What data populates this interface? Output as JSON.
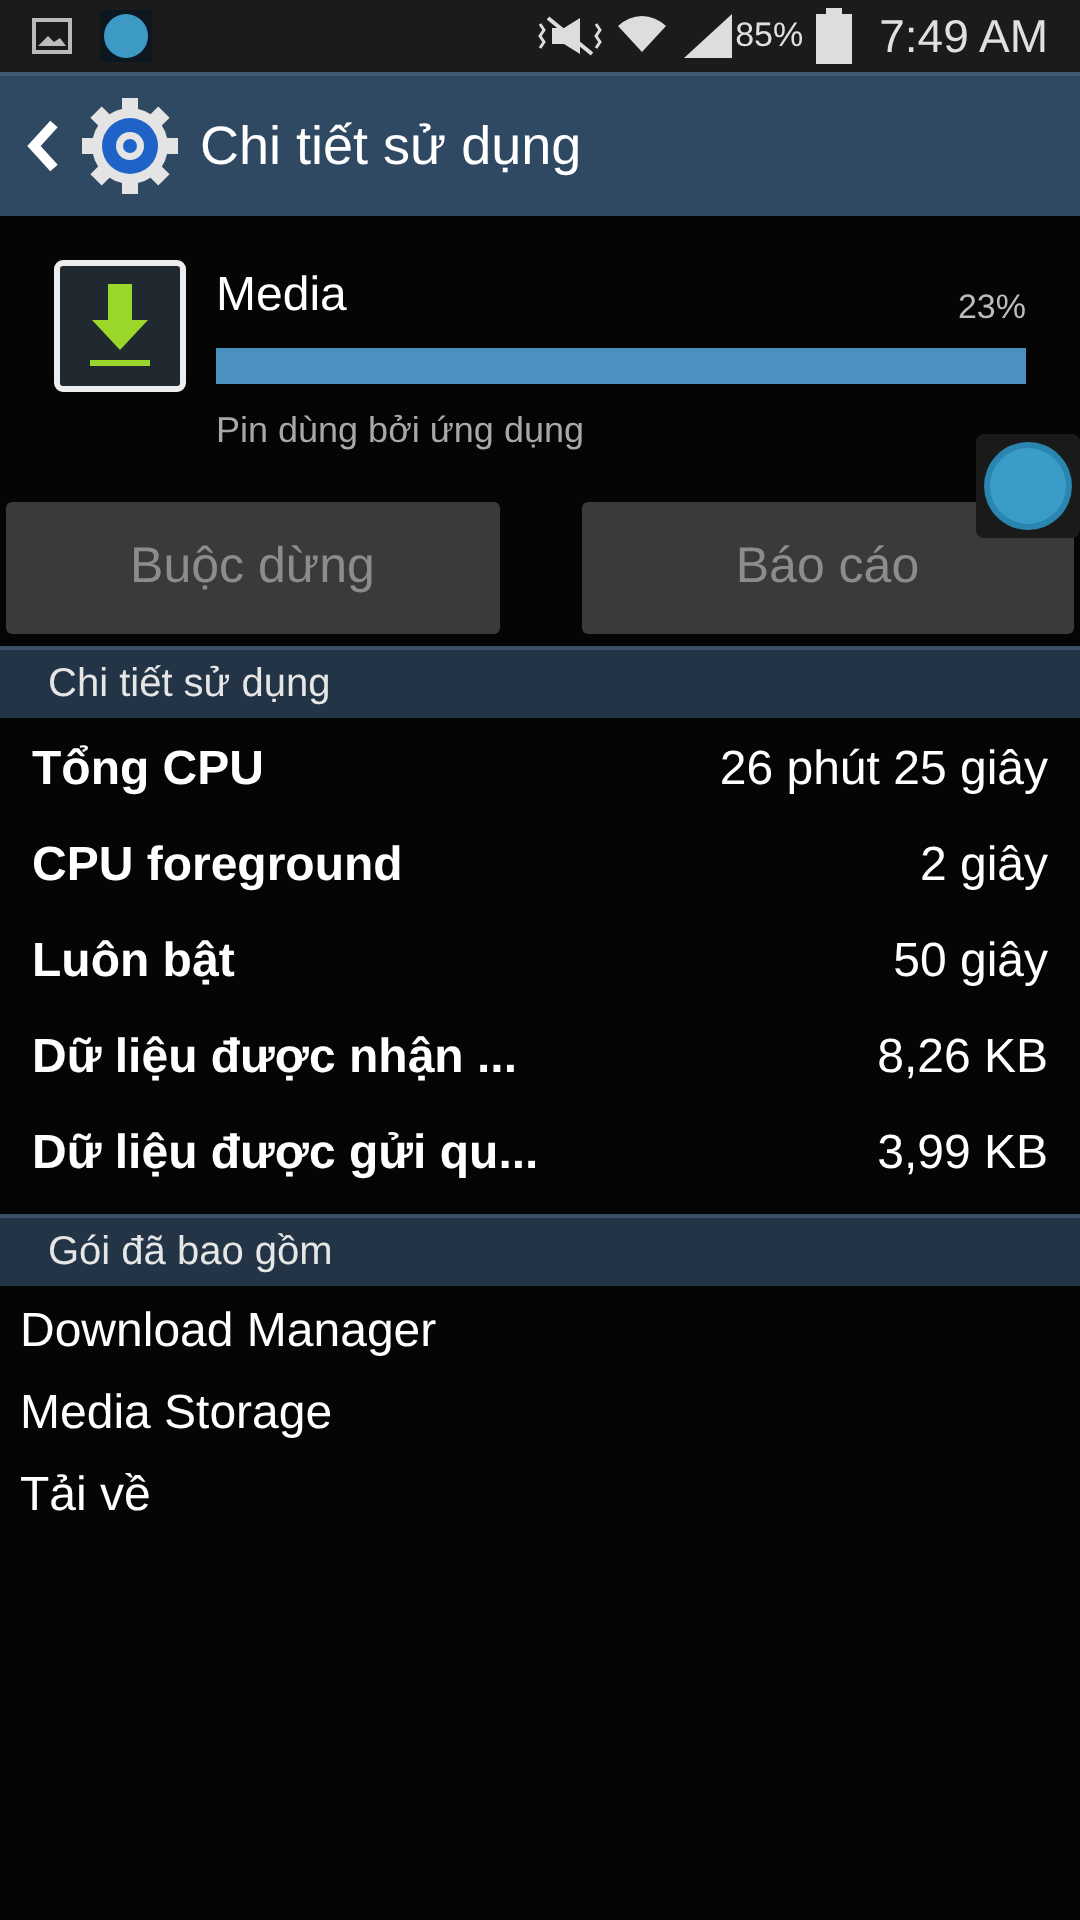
{
  "status_bar": {
    "battery_text": "85%",
    "time": "7:49 AM"
  },
  "action_bar": {
    "title": "Chi tiết sử dụng"
  },
  "app": {
    "name": "Media",
    "percent": "23%",
    "subtitle": "Pin dùng bởi ứng dụng"
  },
  "buttons": [
    {
      "label": "Buộc dừng",
      "disabled": true
    },
    {
      "label": "Báo cáo",
      "disabled": true
    }
  ],
  "usage_section": {
    "title": "Chi tiết sử dụng",
    "rows": [
      {
        "label": "Tổng CPU",
        "value": "26 phút 25 giây"
      },
      {
        "label": "CPU foreground",
        "value": "2 giây"
      },
      {
        "label": "Luôn bật",
        "value": "50 giây"
      },
      {
        "label": "Dữ liệu được nhận ...",
        "value": "8,26 KB"
      },
      {
        "label": "Dữ liệu được gửi qu...",
        "value": "3,99 KB"
      }
    ]
  },
  "packages_section": {
    "title": "Gói đã bao gồm",
    "items": [
      "Download Manager",
      "Media Storage",
      "Tải về"
    ]
  }
}
